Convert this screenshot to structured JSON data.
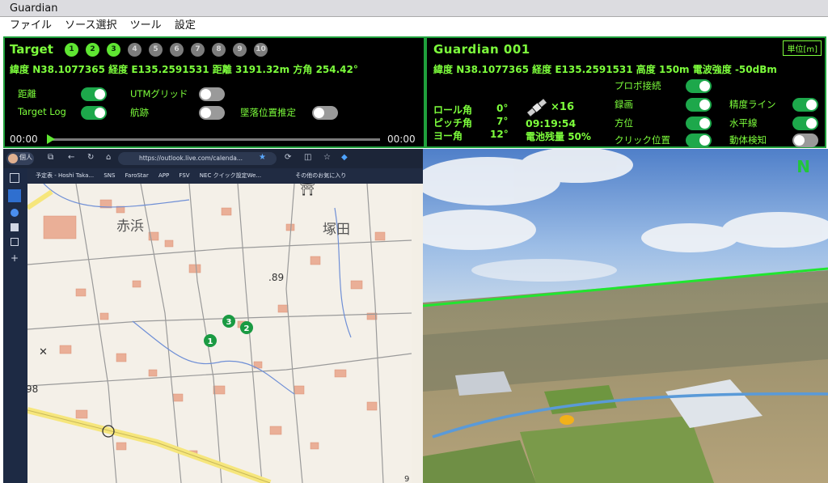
{
  "app": {
    "title": "Guardian"
  },
  "menu": [
    "ファイル",
    "ソース選択",
    "ツール",
    "設定"
  ],
  "target": {
    "label": "Target",
    "numbers": [
      {
        "n": "1",
        "active": true
      },
      {
        "n": "2",
        "active": true
      },
      {
        "n": "3",
        "active": true
      },
      {
        "n": "4",
        "active": false
      },
      {
        "n": "5",
        "active": false
      },
      {
        "n": "6",
        "active": false
      },
      {
        "n": "7",
        "active": false
      },
      {
        "n": "8",
        "active": false
      },
      {
        "n": "9",
        "active": false
      },
      {
        "n": "10",
        "active": false
      }
    ],
    "lat_label": "緯度",
    "lat": "N38.1077365",
    "lon_label": "経度",
    "lon": "E135.2591531",
    "dist_label": "距離",
    "dist": "3191.32m",
    "bearing_label": "方角",
    "bearing": "254.42°",
    "toggles": {
      "distance": {
        "label": "距離",
        "on": true
      },
      "utm": {
        "label": "UTMグリッド",
        "on": false
      },
      "target_log": {
        "label": "Target Log",
        "on": true
      },
      "track": {
        "label": "航跡",
        "on": false
      },
      "crash": {
        "label": "墜落位置推定",
        "on": false
      }
    },
    "time_start": "00:00",
    "time_end": "00:00",
    "progress": 0
  },
  "guardian": {
    "title": "Guardian 001",
    "unit_button": "単位[m]",
    "lat_label": "緯度",
    "lat": "N38.1077365",
    "lon_label": "経度",
    "lon": "E135.2591531",
    "alt_label": "高度",
    "alt": "150m",
    "signal_label": "電波強度",
    "signal": "-50dBm",
    "roll_label": "ロール角",
    "roll": "0°",
    "pitch_label": "ピッチ角",
    "pitch": "7°",
    "yaw_label": "ヨー角",
    "yaw": "12°",
    "sat_count": "×16",
    "time": "09:19:54",
    "battery_label": "電池残量",
    "battery": "50%",
    "toggles": {
      "propo": {
        "label": "プロポ接続",
        "on": true
      },
      "record": {
        "label": "録画",
        "on": true
      },
      "accuracy": {
        "label": "精度ライン",
        "on": true
      },
      "direction": {
        "label": "方位",
        "on": true
      },
      "horizon": {
        "label": "水平線",
        "on": true
      },
      "click_pos": {
        "label": "クリック位置",
        "on": true
      },
      "motion": {
        "label": "動体検知",
        "on": false
      }
    }
  },
  "browser": {
    "profile": "個人",
    "url": "https://outlook.live.com/calenda...",
    "bookmarks": [
      "予定表 - Hoshi Taka...",
      "SNS",
      "FaroStar",
      "APP",
      "FSV",
      "NEC クイック設定We...",
      "その他のお気に入り"
    ]
  },
  "map": {
    "labels": [
      "赤浜",
      "塚田",
      ".89",
      "98",
      "9"
    ],
    "markers": [
      "1",
      "2",
      "3"
    ]
  },
  "video": {
    "north": "N"
  },
  "colors": {
    "panel_bg": "#000000",
    "accent": "#7dff3c",
    "border": "#1fa03c",
    "toggle_on": "#1da84b",
    "toggle_off": "#9a9a9a"
  }
}
